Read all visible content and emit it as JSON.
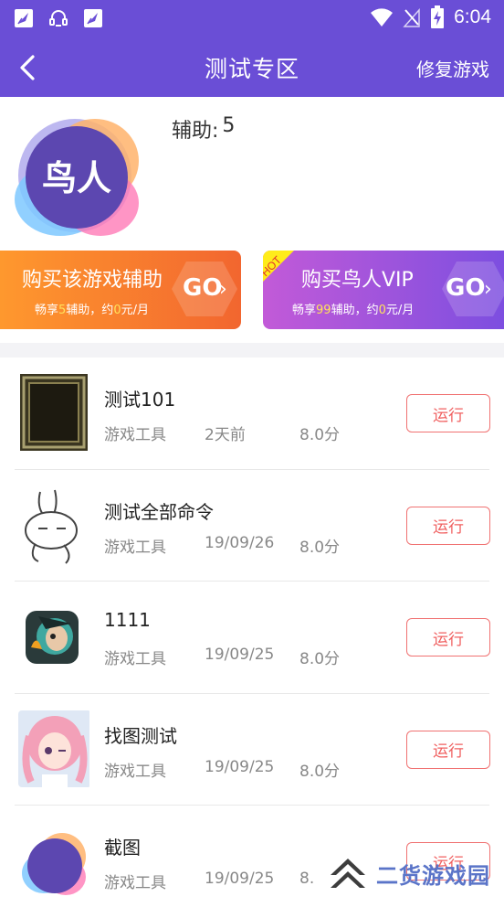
{
  "status_bar": {
    "time": "6:04",
    "icons": [
      "notification-feather-icon",
      "headset-icon",
      "notification-feather-icon",
      "wifi-icon",
      "no-signal-icon",
      "battery-charging-icon"
    ]
  },
  "header": {
    "title": "测试专区",
    "right_action": "修复游戏",
    "back_icon": "chevron-left-icon"
  },
  "app": {
    "logo_text": "鸟人",
    "assist_label": "辅助:",
    "assist_count": "5"
  },
  "banners": [
    {
      "title": "购买该游戏辅助",
      "sub_prefix": "畅享",
      "sub_num": "5",
      "sub_mid": "辅助，约",
      "sub_price": "0",
      "sub_suffix": "元/月",
      "go": "GO",
      "colors": [
        "#ff9a2e",
        "#f2662f"
      ]
    },
    {
      "ribbon": "HOT",
      "title": "购买鸟人VIP",
      "sub_prefix": "畅享",
      "sub_num": "99",
      "sub_mid": "辅助，约",
      "sub_price": "0",
      "sub_suffix": "元/月",
      "go": "GO",
      "colors": [
        "#c25ad8",
        "#7a4ee0"
      ]
    }
  ],
  "games": [
    {
      "title": "测试101",
      "category": "游戏工具",
      "date": "2天前",
      "score": "8.0分",
      "action": "运行",
      "thumb": "dark-frame-game-icon"
    },
    {
      "title": "测试全部命令",
      "category": "游戏工具",
      "date": "19/09/26",
      "score": "8.0分",
      "action": "运行",
      "thumb": "rabbit-sketch-icon"
    },
    {
      "title": "1111",
      "category": "游戏工具",
      "date": "19/09/25",
      "score": "8.0分",
      "action": "运行",
      "thumb": "hero-game-icon"
    },
    {
      "title": "找图测试",
      "category": "游戏工具",
      "date": "19/09/25",
      "score": "8.0分",
      "action": "运行",
      "thumb": "anime-girl-icon"
    },
    {
      "title": "截图",
      "category": "游戏工具",
      "date": "19/09/25",
      "score": "8.",
      "action": "运行",
      "thumb": "birdman-blob-icon"
    }
  ],
  "watermark": {
    "text": "二货游戏园"
  },
  "colors": {
    "primary": "#6a4ed6",
    "run_border": "#f07272",
    "highlight": "#ffe25a"
  }
}
